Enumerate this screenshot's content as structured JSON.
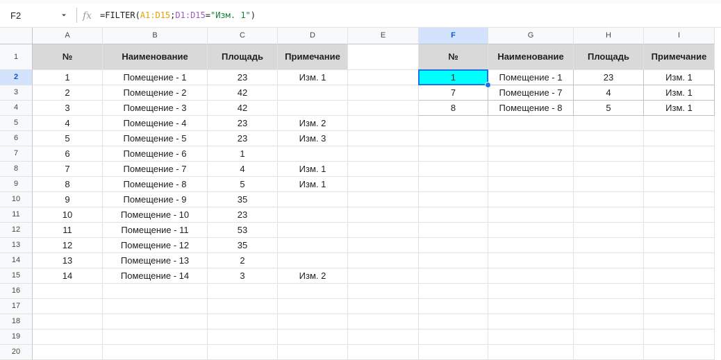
{
  "formula_bar": {
    "cell_ref": "F2",
    "fx_icon": "fx-function-icon",
    "formula_prefix": "=FILTER(",
    "formula_ref1": "A1:D15",
    "formula_sep": ";",
    "formula_ref2": "D1:D15",
    "formula_eq": "=",
    "formula_str": "\"Изм. 1\"",
    "formula_suffix": ")"
  },
  "grid": {
    "columns": [
      "A",
      "B",
      "C",
      "D",
      "E",
      "F",
      "G",
      "H",
      "I"
    ],
    "selected_column": "F",
    "selected_row": 2,
    "active_cell": "F2",
    "row_numbers": [
      "1",
      "2",
      "3",
      "4",
      "5",
      "6",
      "7",
      "8",
      "9",
      "10",
      "11",
      "12",
      "13",
      "14",
      "15",
      "16",
      "17",
      "18",
      "19",
      "20"
    ]
  },
  "source_table": {
    "headers": [
      "№",
      "Наименование",
      "Площадь",
      "Примечание"
    ],
    "rows": [
      [
        "1",
        "Помещение - 1",
        "23",
        "Изм. 1"
      ],
      [
        "2",
        "Помещение - 2",
        "42",
        ""
      ],
      [
        "3",
        "Помещение - 3",
        "42",
        ""
      ],
      [
        "4",
        "Помещение - 4",
        "23",
        "Изм. 2"
      ],
      [
        "5",
        "Помещение - 5",
        "23",
        "Изм. 3"
      ],
      [
        "6",
        "Помещение - 6",
        "1",
        ""
      ],
      [
        "7",
        "Помещение - 7",
        "4",
        "Изм. 1"
      ],
      [
        "8",
        "Помещение - 8",
        "5",
        "Изм. 1"
      ],
      [
        "9",
        "Помещение - 9",
        "35",
        ""
      ],
      [
        "10",
        "Помещение - 10",
        "23",
        ""
      ],
      [
        "11",
        "Помещение - 11",
        "53",
        ""
      ],
      [
        "12",
        "Помещение - 12",
        "35",
        ""
      ],
      [
        "13",
        "Помещение - 13",
        "2",
        ""
      ],
      [
        "14",
        "Помещение - 14",
        "3",
        "Изм. 2"
      ]
    ]
  },
  "filter_result": {
    "headers": [
      "№",
      "Наименование",
      "Площадь",
      "Примечание"
    ],
    "rows": [
      [
        "1",
        "Помещение - 1",
        "23",
        "Изм. 1"
      ],
      [
        "7",
        "Помещение - 7",
        "4",
        "Изм. 1"
      ],
      [
        "8",
        "Помещение - 8",
        "5",
        "Изм. 1"
      ]
    ]
  },
  "colors": {
    "header_fill": "#d9d9d9",
    "active_fill": "#00ffff",
    "selection": "#1a73e8",
    "selected_header": "#d3e3fd"
  }
}
